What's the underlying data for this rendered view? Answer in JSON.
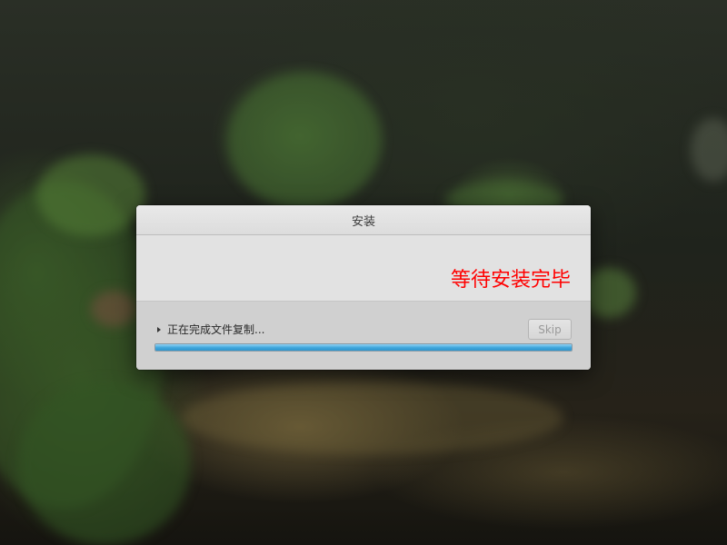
{
  "dialog": {
    "title": "安装",
    "banner_text": "等待安装完毕",
    "status_text": "正在完成文件复制...",
    "skip_label": "Skip",
    "progress_fraction": 1.0
  },
  "colors": {
    "banner_text": "#ff0000",
    "progress": "#3fa6dc"
  },
  "icons": {
    "expander": "triangle-right-icon"
  }
}
